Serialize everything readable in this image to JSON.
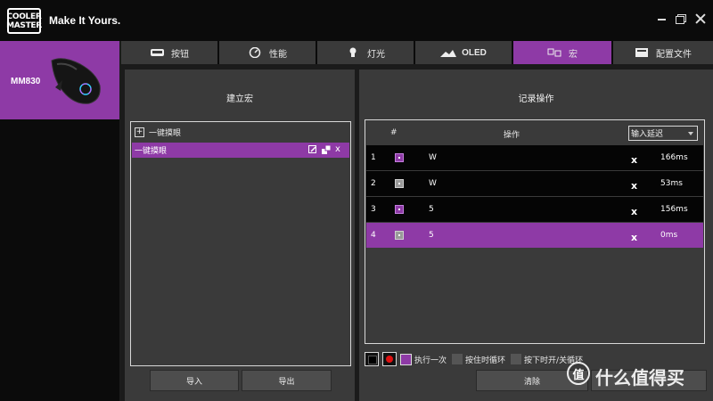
{
  "brand": {
    "logo_line1": "COOLER",
    "logo_line2": "MASTER",
    "tagline": "Make It Yours."
  },
  "device": {
    "name": "MM830"
  },
  "tabs": [
    {
      "label": "按钮",
      "icon": "button-icon"
    },
    {
      "label": "性能",
      "icon": "performance-icon"
    },
    {
      "label": "灯光",
      "icon": "lighting-icon"
    },
    {
      "label": "OLED",
      "icon": "oled-icon"
    },
    {
      "label": "宏",
      "icon": "macro-icon",
      "active": true
    },
    {
      "label": "配置文件",
      "icon": "profile-icon"
    }
  ],
  "left": {
    "title": "建立宏",
    "add_label": "一键摸眼",
    "selected_macro": "一键摸眼",
    "import_label": "导入",
    "export_label": "导出"
  },
  "right": {
    "title": "记录操作",
    "col_num": "#",
    "col_op": "操作",
    "delay_select": "输入延迟",
    "rows": [
      {
        "idx": "1",
        "action": "down",
        "key": "W",
        "delay": "166ms"
      },
      {
        "idx": "2",
        "action": "up",
        "key": "W",
        "delay": "53ms"
      },
      {
        "idx": "3",
        "action": "down",
        "key": "5",
        "delay": "156ms"
      },
      {
        "idx": "4",
        "action": "up",
        "key": "5",
        "delay": "0ms",
        "selected": true
      }
    ],
    "opt_once": "执行一次",
    "opt_hold": "按住时循环",
    "opt_toggle": "按下时开/关循环",
    "clear_label": "清除"
  },
  "watermark": {
    "badge": "值",
    "text": "什么值得买"
  },
  "colors": {
    "accent": "#8e3aa6",
    "panel": "#3a3a3a",
    "background": "#0b0b0b"
  }
}
